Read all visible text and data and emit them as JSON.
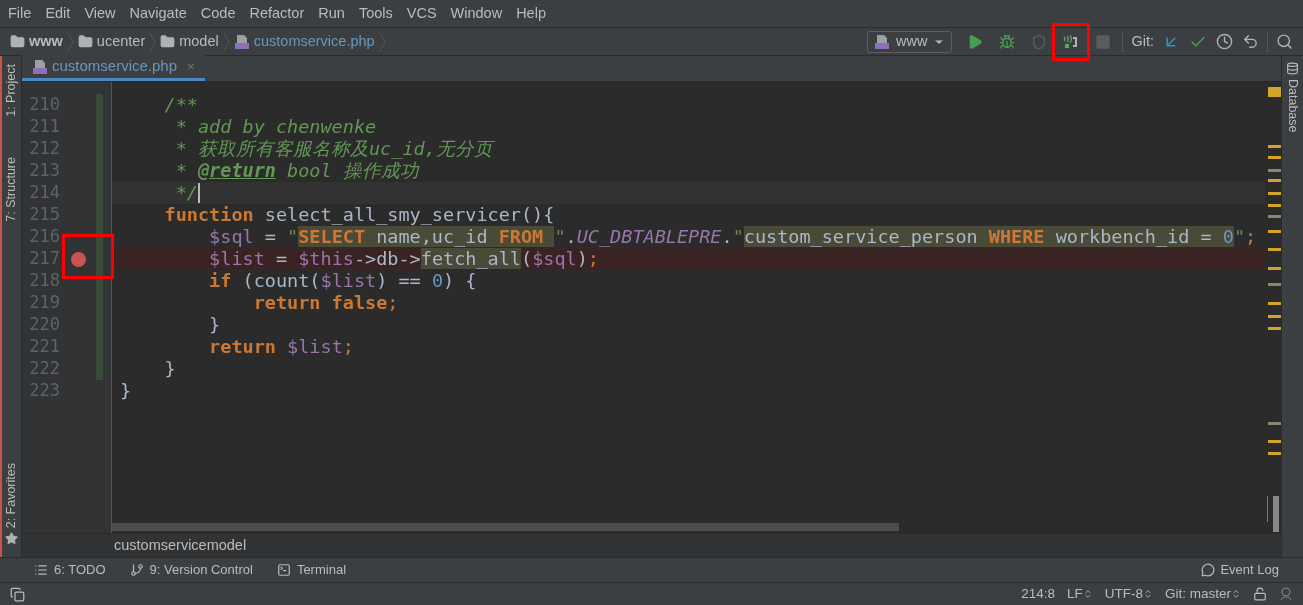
{
  "menu": [
    "File",
    "Edit",
    "View",
    "Navigate",
    "Code",
    "Refactor",
    "Run",
    "Tools",
    "VCS",
    "Window",
    "Help"
  ],
  "breadcrumbs": [
    {
      "kind": "folder",
      "label": "www"
    },
    {
      "kind": "folder",
      "label": "ucenter"
    },
    {
      "kind": "folder",
      "label": "model"
    },
    {
      "kind": "php",
      "label": "customservice.php"
    }
  ],
  "run_config": "www",
  "toolbar": [
    {
      "kind": "run",
      "disabled": false,
      "marked": false
    },
    {
      "kind": "debug",
      "disabled": false,
      "marked": false
    },
    {
      "kind": "coverage",
      "disabled": true,
      "marked": false
    },
    {
      "kind": "listen",
      "disabled": false,
      "marked": true
    },
    {
      "kind": "stop",
      "disabled": true,
      "marked": false
    }
  ],
  "git_label": "Git:",
  "left_tools": [
    "1: Project",
    "7: Structure",
    "2: Favorites"
  ],
  "right_tools": [
    "Database"
  ],
  "tabs": [
    {
      "label": "customservice.php",
      "selected": true,
      "close": "×"
    }
  ],
  "lines": [
    {
      "number": "210",
      "current": false,
      "breakpoint": false,
      "marked": false,
      "tokens": [
        {
          "kind": "comment",
          "text": "    /**"
        }
      ]
    },
    {
      "number": "211",
      "current": false,
      "breakpoint": false,
      "marked": false,
      "tokens": [
        {
          "kind": "comment",
          "text": "     * add by chenwenke"
        }
      ]
    },
    {
      "number": "212",
      "current": false,
      "breakpoint": false,
      "marked": false,
      "tokens": [
        {
          "kind": "comment",
          "text": "     * 获取所有客服名称及uc_id,无分页"
        }
      ]
    },
    {
      "number": "213",
      "current": false,
      "breakpoint": false,
      "marked": false,
      "tokens": [
        {
          "kind": "comment",
          "text": "     * "
        },
        {
          "kind": "doctag",
          "text": "@return"
        },
        {
          "kind": "comment",
          "text": " bool 操作成功"
        }
      ]
    },
    {
      "number": "214",
      "current": true,
      "breakpoint": false,
      "marked": false,
      "tokens": [
        {
          "kind": "comment",
          "text": "     */"
        }
      ]
    },
    {
      "number": "215",
      "current": false,
      "breakpoint": false,
      "marked": false,
      "tokens": [
        {
          "kind": "keyword",
          "text": "    function"
        },
        {
          "kind": "plain",
          "text": " select_all_smy_servicer(){"
        }
      ]
    },
    {
      "number": "216",
      "current": false,
      "breakpoint": false,
      "marked": false,
      "tokens": [
        {
          "kind": "var",
          "text": "        $sql"
        },
        {
          "kind": "plain",
          "text": " = "
        },
        {
          "kind": "string",
          "text": "\""
        },
        {
          "kind": "sql-keyword",
          "text": "SELECT"
        },
        {
          "kind": "sql",
          "text": " name,uc_id "
        },
        {
          "kind": "sql-keyword",
          "text": "FROM "
        },
        {
          "kind": "string",
          "text": "\""
        },
        {
          "kind": "plain",
          "text": "."
        },
        {
          "kind": "constant",
          "text": "UC_DBTABLEPRE"
        },
        {
          "kind": "plain",
          "text": "."
        },
        {
          "kind": "string",
          "text": "\""
        },
        {
          "kind": "sql",
          "text": "custom_service_person "
        },
        {
          "kind": "sql-keyword",
          "text": "WHERE"
        },
        {
          "kind": "sql",
          "text": " workbench_id = "
        },
        {
          "kind": "sql-number",
          "text": "0"
        },
        {
          "kind": "string",
          "text": "\""
        },
        {
          "kind": "punct",
          "text": ";"
        }
      ]
    },
    {
      "number": "217",
      "current": false,
      "breakpoint": true,
      "marked": true,
      "tokens": [
        {
          "kind": "var",
          "text": "        $list"
        },
        {
          "kind": "plain",
          "text": " = "
        },
        {
          "kind": "var",
          "text": "$this"
        },
        {
          "kind": "plain",
          "text": "->db->"
        },
        {
          "kind": "sql",
          "text": "fetch_all"
        },
        {
          "kind": "plain",
          "text": "("
        },
        {
          "kind": "var",
          "text": "$sql"
        },
        {
          "kind": "plain",
          "text": ")"
        },
        {
          "kind": "punct",
          "text": ";"
        }
      ]
    },
    {
      "number": "218",
      "current": false,
      "breakpoint": false,
      "marked": false,
      "tokens": [
        {
          "kind": "keyword",
          "text": "        if"
        },
        {
          "kind": "plain",
          "text": " (count("
        },
        {
          "kind": "var",
          "text": "$list"
        },
        {
          "kind": "plain",
          "text": ") == "
        },
        {
          "kind": "number",
          "text": "0"
        },
        {
          "kind": "plain",
          "text": ") {"
        }
      ]
    },
    {
      "number": "219",
      "current": false,
      "breakpoint": false,
      "marked": false,
      "tokens": [
        {
          "kind": "keyword",
          "text": "            return false"
        },
        {
          "kind": "punct",
          "text": ";"
        }
      ]
    },
    {
      "number": "220",
      "current": false,
      "breakpoint": false,
      "marked": false,
      "tokens": [
        {
          "kind": "plain",
          "text": "        }"
        }
      ]
    },
    {
      "number": "221",
      "current": false,
      "breakpoint": false,
      "marked": false,
      "tokens": [
        {
          "kind": "keyword",
          "text": "        return "
        },
        {
          "kind": "var",
          "text": "$list"
        },
        {
          "kind": "punct",
          "text": ";"
        }
      ]
    },
    {
      "number": "222",
      "current": false,
      "breakpoint": false,
      "marked": false,
      "tokens": [
        {
          "kind": "plain",
          "text": "    }"
        }
      ]
    },
    {
      "number": "223",
      "current": false,
      "breakpoint": false,
      "marked": false,
      "tokens": [
        {
          "kind": "plain",
          "text": "}"
        }
      ]
    }
  ],
  "code_breadcrumb": "customservicemodel",
  "tool_windows": [
    {
      "kind": "todo",
      "label": "6: TODO"
    },
    {
      "kind": "vcs",
      "label": "9: Version Control"
    },
    {
      "kind": "terminal",
      "label": "Terminal"
    }
  ],
  "event_log": "Event Log",
  "status": {
    "position": "214:8",
    "line_separator": "LF",
    "encoding": "UTF-8",
    "branch": "Git: master"
  }
}
